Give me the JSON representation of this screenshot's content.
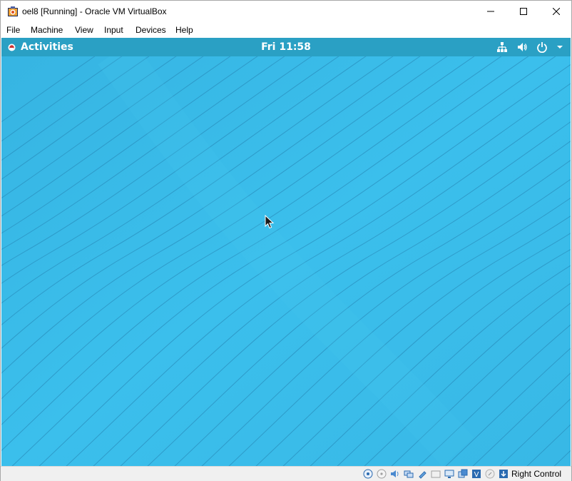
{
  "window": {
    "title": "oel8 [Running] - Oracle VM VirtualBox",
    "icon": "virtualbox-app-icon"
  },
  "menu": {
    "items": [
      {
        "label": "File"
      },
      {
        "label": "Machine"
      },
      {
        "label": "View"
      },
      {
        "label": "Input"
      },
      {
        "label": "Devices"
      },
      {
        "label": "Help"
      }
    ]
  },
  "guest": {
    "activities_label": "Activities",
    "clock": "Fri 11:58",
    "tray_icons": [
      "network-icon",
      "volume-icon",
      "power-icon",
      "dropdown-arrow-icon"
    ],
    "wallpaper_colors": {
      "base": "#35b6e4",
      "light": "#3fc3ef",
      "line": "#2a8fbd"
    }
  },
  "statusbar": {
    "icons": [
      "hard-disk-icon",
      "optical-drive-icon",
      "audio-icon",
      "network-adapter-icon",
      "usb-icon",
      "shared-folders-icon",
      "display-icon",
      "video-capture-icon",
      "virtualization-icon",
      "mouse-integration-icon",
      "keyboard-capture-icon"
    ],
    "host_key_label": "Right Control"
  }
}
